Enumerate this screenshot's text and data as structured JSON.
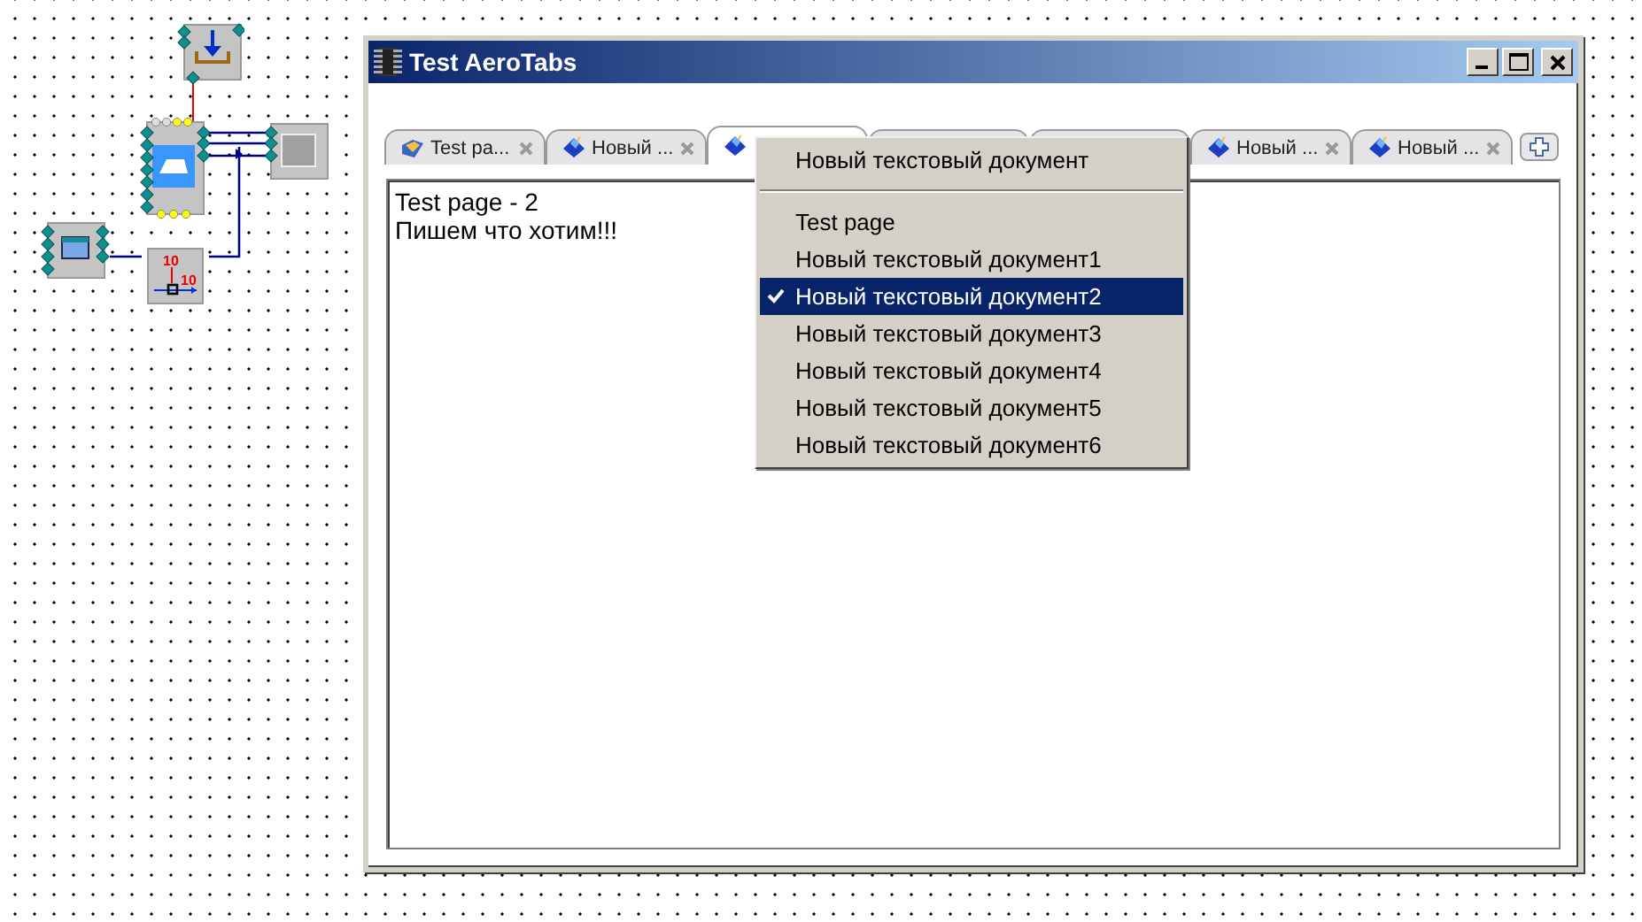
{
  "diagram": {
    "counter_labels": [
      "10",
      "10"
    ]
  },
  "window": {
    "title": "Test AeroTabs"
  },
  "tabs": [
    {
      "kind": "page",
      "label": "Test pa...",
      "selected": false
    },
    {
      "kind": "document",
      "label": "Новый ...",
      "selected": false
    },
    {
      "kind": "document",
      "selected": true
    },
    {
      "kind": "document",
      "selected": false
    },
    {
      "kind": "document",
      "selected": false
    },
    {
      "kind": "document",
      "label": "Новый ...",
      "selected": false
    },
    {
      "kind": "document",
      "label": "Новый ...",
      "selected": false
    }
  ],
  "content": {
    "lines": [
      "Test page - 2",
      "Пишем что хотим!!!"
    ]
  },
  "menu": {
    "items": [
      {
        "kind": "item",
        "label": "Новый текстовый документ",
        "checked": false,
        "selected": false
      },
      {
        "kind": "separator"
      },
      {
        "kind": "item",
        "label": "Test page",
        "checked": false,
        "selected": false
      },
      {
        "kind": "item",
        "label": "Новый текстовый документ1",
        "checked": false,
        "selected": false
      },
      {
        "kind": "item",
        "label": "Новый текстовый документ2",
        "checked": true,
        "selected": true
      },
      {
        "kind": "item",
        "label": "Новый текстовый документ3",
        "checked": false,
        "selected": false
      },
      {
        "kind": "item",
        "label": "Новый текстовый документ4",
        "checked": false,
        "selected": false
      },
      {
        "kind": "item",
        "label": "Новый текстовый документ5",
        "checked": false,
        "selected": false
      },
      {
        "kind": "item",
        "label": "Новый текстовый документ6",
        "checked": false,
        "selected": false
      }
    ]
  }
}
